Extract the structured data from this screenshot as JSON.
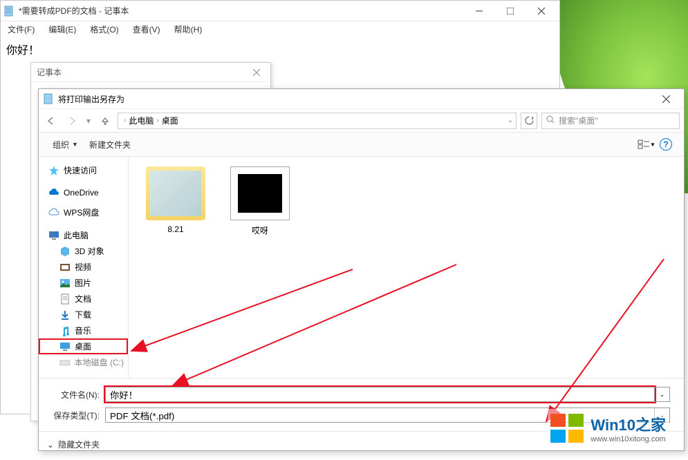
{
  "notepad": {
    "title": "*需要转成PDF的文档 - 记事本",
    "menu": {
      "file": "文件(F)",
      "edit": "编辑(E)",
      "format": "格式(O)",
      "view": "查看(V)",
      "help": "帮助(H)"
    },
    "content": "你好！"
  },
  "small_dialog": {
    "title": "记事本"
  },
  "saveas": {
    "title": "将打印输出另存为",
    "breadcrumb": {
      "root": "此电脑",
      "current": "桌面"
    },
    "search_placeholder": "搜索\"桌面\"",
    "toolbar": {
      "organize": "组织",
      "new_folder": "新建文件夹"
    },
    "tree": {
      "quick_access": "快速访问",
      "onedrive": "OneDrive",
      "wps": "WPS网盘",
      "this_pc": "此电脑",
      "objects_3d": "3D 对象",
      "videos": "视频",
      "pictures": "图片",
      "documents": "文档",
      "downloads": "下载",
      "music": "音乐",
      "desktop": "桌面",
      "local_disk": "本地磁盘 (C:)"
    },
    "files": {
      "folder1": "8.21",
      "image1": "哎呀"
    },
    "fields": {
      "filename_label": "文件名(N):",
      "filename_value": "你好！",
      "filetype_label": "保存类型(T):",
      "filetype_value": "PDF 文档(*.pdf)"
    },
    "footer": {
      "hide_folders": "隐藏文件夹"
    }
  },
  "watermark": {
    "brand": "Win10之家",
    "url": "www.win10xitong.com"
  }
}
